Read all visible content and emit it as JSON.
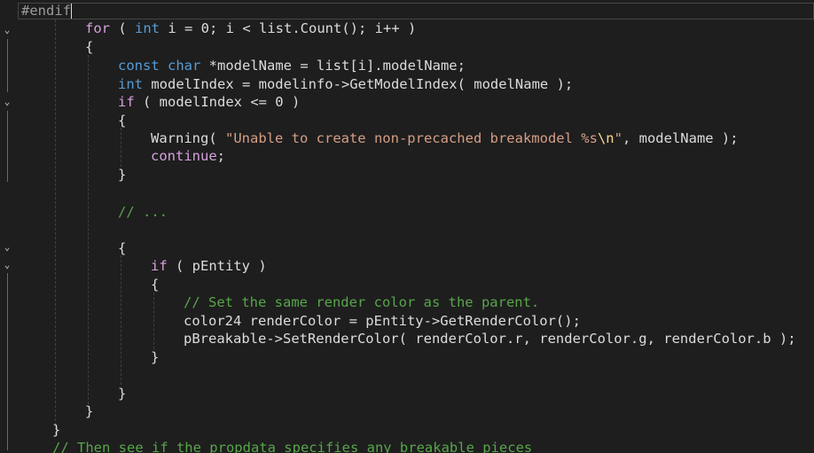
{
  "editor": {
    "lines": [
      {
        "id": "l1",
        "tokens": [
          {
            "t": "#endif",
            "c": "pp"
          }
        ]
      },
      {
        "id": "l2",
        "tokens": [
          {
            "t": "for",
            "c": "ctl"
          },
          {
            "t": " ( ",
            "c": "punc"
          },
          {
            "t": "int",
            "c": "kw"
          },
          {
            "t": " i = ",
            "c": "var"
          },
          {
            "t": "0",
            "c": "var"
          },
          {
            "t": "; i < list.Count(); i++ )",
            "c": "var"
          }
        ]
      },
      {
        "id": "l3",
        "tokens": [
          {
            "t": "{",
            "c": "punc"
          }
        ]
      },
      {
        "id": "l4",
        "tokens": [
          {
            "t": "const",
            "c": "kw"
          },
          {
            "t": " ",
            "c": "var"
          },
          {
            "t": "char",
            "c": "kw"
          },
          {
            "t": " *modelName = list[i].modelName;",
            "c": "var"
          }
        ]
      },
      {
        "id": "l5",
        "tokens": [
          {
            "t": "int",
            "c": "kw"
          },
          {
            "t": " modelIndex = modelinfo->GetModelIndex( modelName );",
            "c": "var"
          }
        ]
      },
      {
        "id": "l6",
        "tokens": [
          {
            "t": "if",
            "c": "ctl"
          },
          {
            "t": " ( modelIndex <= 0 )",
            "c": "var"
          }
        ]
      },
      {
        "id": "l7",
        "tokens": [
          {
            "t": "{",
            "c": "punc"
          }
        ]
      },
      {
        "id": "l8",
        "tokens": [
          {
            "t": "Warning( ",
            "c": "var"
          },
          {
            "t": "\"Unable to create non-precached breakmodel %s",
            "c": "str"
          },
          {
            "t": "\\n",
            "c": "esc"
          },
          {
            "t": "\"",
            "c": "str"
          },
          {
            "t": ", modelName );",
            "c": "var"
          }
        ]
      },
      {
        "id": "l9",
        "tokens": [
          {
            "t": "continue",
            "c": "ctl"
          },
          {
            "t": ";",
            "c": "var"
          }
        ]
      },
      {
        "id": "l10",
        "tokens": [
          {
            "t": "}",
            "c": "punc"
          }
        ]
      },
      {
        "id": "l11",
        "tokens": []
      },
      {
        "id": "l12",
        "tokens": [
          {
            "t": "// ...",
            "c": "cmt"
          }
        ]
      },
      {
        "id": "l13",
        "tokens": []
      },
      {
        "id": "l14",
        "tokens": [
          {
            "t": "{",
            "c": "punc"
          }
        ]
      },
      {
        "id": "l15",
        "tokens": [
          {
            "t": "if",
            "c": "ctl"
          },
          {
            "t": " ( pEntity )",
            "c": "var"
          }
        ]
      },
      {
        "id": "l16",
        "tokens": [
          {
            "t": "{",
            "c": "punc"
          }
        ]
      },
      {
        "id": "l17",
        "tokens": [
          {
            "t": "// Set the same render color as the parent.",
            "c": "cmt"
          }
        ]
      },
      {
        "id": "l18",
        "tokens": [
          {
            "t": "color24 renderColor = pEntity->GetRenderColor();",
            "c": "var"
          }
        ]
      },
      {
        "id": "l19",
        "tokens": [
          {
            "t": "pBreakable->SetRenderColor( renderColor.r, renderColor.g, renderColor.b );",
            "c": "var"
          }
        ]
      },
      {
        "id": "l20",
        "tokens": [
          {
            "t": "}",
            "c": "punc"
          }
        ]
      },
      {
        "id": "l21",
        "tokens": []
      },
      {
        "id": "l22",
        "tokens": [
          {
            "t": "}",
            "c": "punc"
          }
        ]
      },
      {
        "id": "l23",
        "tokens": [
          {
            "t": "}",
            "c": "punc"
          }
        ]
      },
      {
        "id": "l24",
        "tokens": [
          {
            "t": "}",
            "c": "punc"
          }
        ]
      },
      {
        "id": "l25",
        "tokens": [
          {
            "t": "// Then see if the propdata specifies any breakable pieces",
            "c": "cmt"
          }
        ]
      }
    ]
  },
  "colors": {
    "background": "#1e1e1e",
    "keyword": "#569cd6",
    "control": "#d8a0df",
    "string": "#d69d85",
    "escape": "#ffd68f",
    "comment": "#57a64a",
    "preprocessor": "#9b9b9b",
    "text": "#dcdcdc"
  },
  "gutter": {
    "fold_icons": [
      "chevron-down-icon",
      "chevron-down-icon",
      "chevron-down-icon",
      "chevron-down-icon"
    ]
  }
}
